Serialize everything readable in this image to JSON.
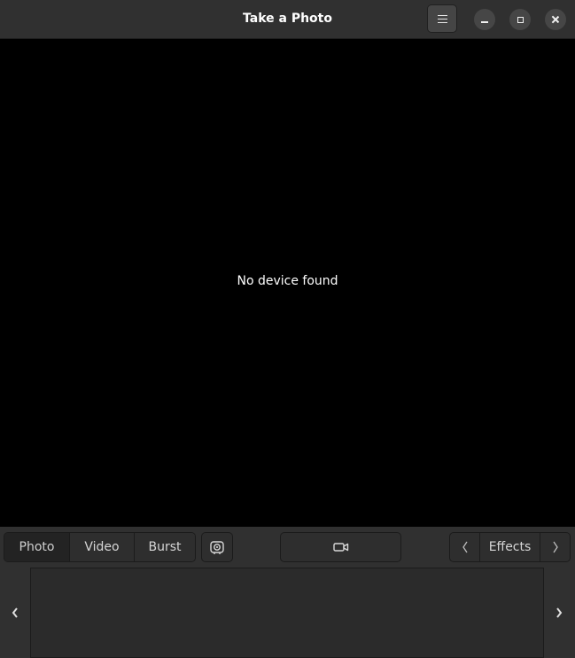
{
  "window": {
    "title": "Take a Photo"
  },
  "viewport": {
    "message": "No device found"
  },
  "toolbar": {
    "modes": [
      {
        "label": "Photo",
        "active": true
      },
      {
        "label": "Video",
        "active": false
      },
      {
        "label": "Burst",
        "active": false
      }
    ],
    "effects_label": "Effects"
  },
  "icons": {
    "menu": "hamburger-icon",
    "minimize": "minimize-icon",
    "maximize": "maximize-icon",
    "close": "close-icon",
    "cheese": "cheese-icon",
    "capture": "video-camera-icon",
    "prev": "chevron-left-icon",
    "next": "chevron-right-icon"
  },
  "colors": {
    "headerbar": "#303030",
    "viewport": "#000000",
    "text": "#ffffff"
  }
}
